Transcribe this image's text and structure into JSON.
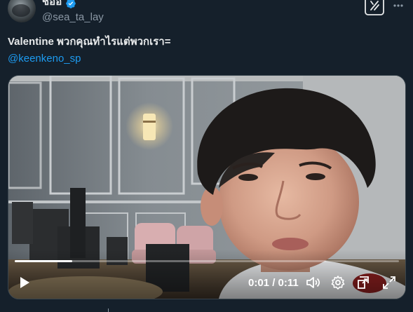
{
  "author": {
    "display_name": "ชออ",
    "handle": "@sea_ta_lay",
    "verified": true
  },
  "tweet": {
    "text": "Valentine พวกคุณทำไรแต่พวกเรา=",
    "mention": "@keenkeno_sp"
  },
  "video": {
    "time_display": "0:01 / 0:11",
    "progress": 0.15
  },
  "icons": {
    "verified": "verified-badge-icon",
    "grok": "grok-icon",
    "more": "more-options-icon",
    "play": "play-icon",
    "volume": "volume-icon",
    "settings": "settings-gear-icon",
    "dock": "dock-icon",
    "fullscreen": "fullscreen-icon"
  },
  "colors": {
    "background": "#15202b",
    "accent": "#1d9bf0",
    "text": "#e7e9ea",
    "muted": "#8b98a5"
  }
}
